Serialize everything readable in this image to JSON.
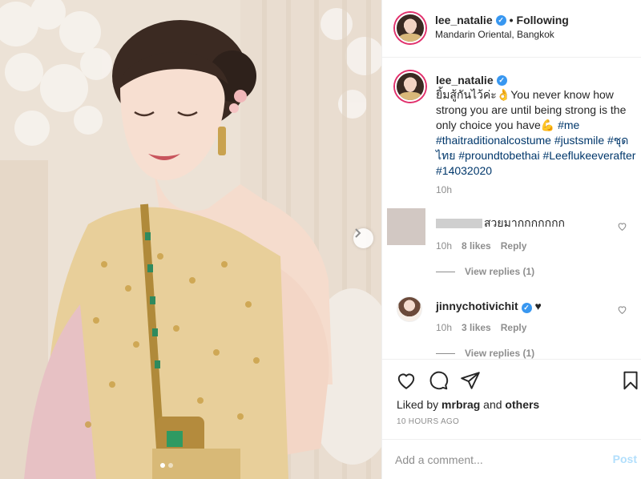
{
  "post": {
    "image_alt": "Woman in Thai traditional costume",
    "carousel_dots": 2,
    "carousel_active": 1
  },
  "header": {
    "username": "lee_natalie",
    "separator": "•",
    "follow_status": "Following",
    "location": "Mandarin Oriental, Bangkok"
  },
  "caption": {
    "username": "lee_natalie",
    "text_plain": "ยิ้มสู้กันไว้ค่ะ👌You never know how strong you are until being strong is the only choice you have💪",
    "hashtags": [
      "#me",
      "#thaitraditionalcostume",
      "#justsmile",
      "#ชุดไทย",
      "#proundtobethai",
      "#Leeflukeeverafter",
      "#14032020"
    ],
    "time": "10h"
  },
  "comments": [
    {
      "username": "",
      "text": "สวยมากกกกกกก",
      "time": "10h",
      "likes": "8 likes",
      "reply": "Reply",
      "view_replies": "View replies (1)"
    },
    {
      "username": "jinnychotivichit",
      "text": "♥",
      "time": "10h",
      "likes": "3 likes",
      "reply": "Reply",
      "view_replies": "View replies (1)"
    }
  ],
  "likes": {
    "prefix": "Liked by",
    "user": "mrbrag",
    "and": "and",
    "others": "others"
  },
  "timestamp": "10 HOURS AGO",
  "add_comment": {
    "placeholder": "Add a comment...",
    "post_label": "Post"
  },
  "colors": {
    "link": "#00376b",
    "muted": "#8e8e8e",
    "verified": "#3897f0",
    "post_disabled": "#b2dffc"
  }
}
